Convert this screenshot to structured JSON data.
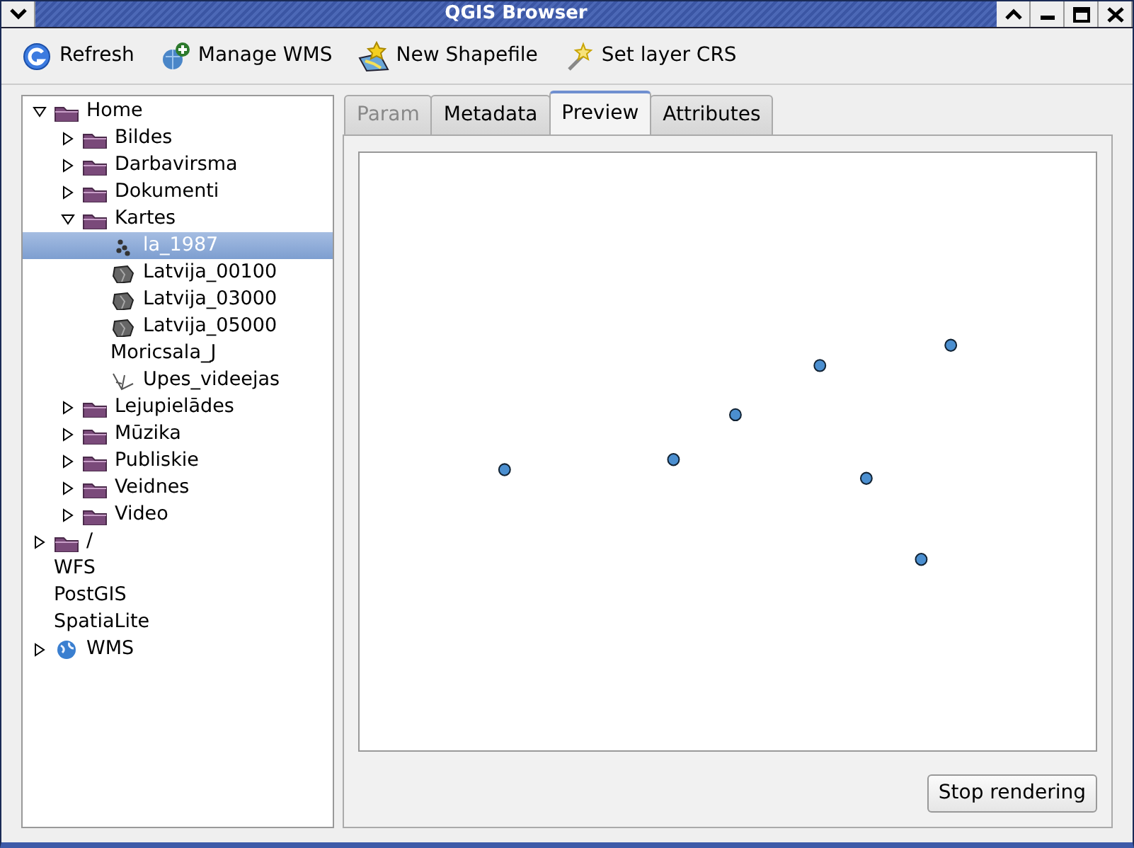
{
  "window": {
    "title": "QGIS Browser"
  },
  "toolbar": [
    {
      "label": "Refresh",
      "kind": "refresh"
    },
    {
      "label": "Manage WMS",
      "kind": "wms"
    },
    {
      "label": "New Shapefile",
      "kind": "shapefile"
    },
    {
      "label": "Set layer CRS",
      "kind": "crs"
    }
  ],
  "tree": [
    {
      "label": "Home",
      "kind": "folder",
      "expanded": true,
      "selected": false,
      "children": [
        {
          "label": "Bildes",
          "kind": "folder",
          "expanded": false,
          "selected": false
        },
        {
          "label": "Darbavirsma",
          "kind": "folder",
          "expanded": false,
          "selected": false
        },
        {
          "label": "Dokumenti",
          "kind": "folder",
          "expanded": false,
          "selected": false
        },
        {
          "label": "Kartes",
          "kind": "folder",
          "expanded": true,
          "selected": false,
          "children": [
            {
              "label": "la_1987",
              "kind": "points",
              "selected": true
            },
            {
              "label": "Latvija_00100",
              "kind": "polygon",
              "selected": false
            },
            {
              "label": "Latvija_03000",
              "kind": "polygon",
              "selected": false
            },
            {
              "label": "Latvija_05000",
              "kind": "polygon",
              "selected": false
            },
            {
              "label": "Moricsala_J",
              "kind": "plain",
              "selected": false
            },
            {
              "label": "Upes_videejas",
              "kind": "line",
              "selected": false
            }
          ]
        },
        {
          "label": "Lejupielādes",
          "kind": "folder",
          "expanded": false,
          "selected": false
        },
        {
          "label": "Mūzika",
          "kind": "folder",
          "expanded": false,
          "selected": false
        },
        {
          "label": "Publiskie",
          "kind": "folder",
          "expanded": false,
          "selected": false
        },
        {
          "label": "Veidnes",
          "kind": "folder",
          "expanded": false,
          "selected": false
        },
        {
          "label": "Video",
          "kind": "folder",
          "expanded": false,
          "selected": false
        }
      ]
    },
    {
      "label": "/",
      "kind": "folder",
      "expanded": false,
      "selected": false
    },
    {
      "label": "WFS",
      "kind": "plain",
      "selected": false
    },
    {
      "label": "PostGIS",
      "kind": "plain",
      "selected": false
    },
    {
      "label": "SpatiaLite",
      "kind": "plain",
      "selected": false
    },
    {
      "label": "WMS",
      "kind": "globe",
      "expanded": false,
      "selected": false
    }
  ],
  "tabs": [
    {
      "label": "Param",
      "selected": false,
      "disabled": true
    },
    {
      "label": "Metadata",
      "selected": false,
      "disabled": false
    },
    {
      "label": "Preview",
      "selected": true,
      "disabled": false
    },
    {
      "label": "Attributes",
      "selected": false,
      "disabled": false
    }
  ],
  "preview": {
    "button": "Stop rendering"
  }
}
